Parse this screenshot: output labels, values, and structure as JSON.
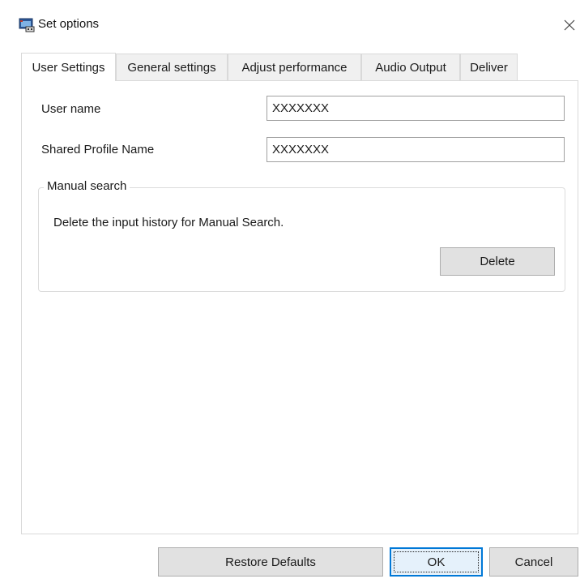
{
  "window": {
    "title": "Set options"
  },
  "tabs": [
    {
      "label": "User Settings",
      "active": true
    },
    {
      "label": "General settings",
      "active": false
    },
    {
      "label": "Adjust performance",
      "active": false
    },
    {
      "label": "Audio Output",
      "active": false
    },
    {
      "label": "Deliver",
      "active": false
    }
  ],
  "user_settings": {
    "user_name_label": "User name",
    "user_name_value": "XXXXXXX",
    "shared_profile_label": "Shared Profile Name",
    "shared_profile_value": "XXXXXXX",
    "manual_search": {
      "legend": "Manual search",
      "description": "Delete the input history for Manual Search.",
      "delete_label": "Delete"
    }
  },
  "footer": {
    "restore_label": "Restore Defaults",
    "ok_label": "OK",
    "cancel_label": "Cancel"
  },
  "icons": {
    "app": "app-window-icon",
    "close": "close-icon"
  },
  "colors": {
    "default_button_border": "#0078d7",
    "default_button_bg": "#e5f1fb"
  }
}
